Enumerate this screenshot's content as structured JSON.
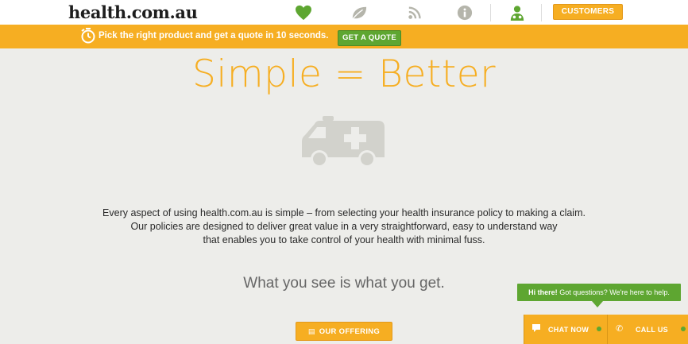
{
  "header": {
    "logo": "health.com.au",
    "nav_icons": [
      "heart-icon",
      "leaf-icon",
      "rss-icon",
      "info-icon",
      "doctor-icon"
    ],
    "customers_label": "CUSTOMERS"
  },
  "quote_bar": {
    "text": "Pick the right product and get a quote in 10 seconds.",
    "button_label": "GET A QUOTE"
  },
  "main": {
    "headline": "Simple = Better",
    "body_lines": [
      "Every aspect of using health.com.au is simple – from selecting your health insurance policy to making a claim.",
      "Our policies are designed to deliver great value in a very straightforward, easy to understand way",
      "that enables you to take control of your health with minimal fuss."
    ],
    "subheadline": "What you see is what you get.",
    "offering_label": "OUR OFFERING"
  },
  "chat": {
    "tooltip_bold": "Hi there!",
    "tooltip_text": " Got questions? We're here to help.",
    "chat_label": "CHAT NOW",
    "call_label": "CALL US"
  },
  "colors": {
    "accent": "#f6ae22",
    "green": "#5ea631",
    "background": "#ededea",
    "icon_grey": "#b5b5ab"
  }
}
